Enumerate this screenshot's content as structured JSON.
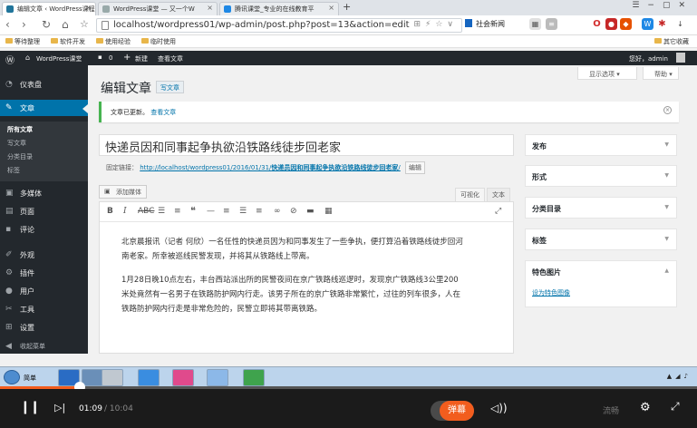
{
  "browser": {
    "tabs": [
      {
        "title": "编辑文章 ‹ WordPress课程"
      },
      {
        "title": "WordPress课堂 — 又一个W"
      },
      {
        "title": "腾讯课堂_专业的在线教育平"
      }
    ],
    "url": "localhost/wordpress01/wp-admin/post.php?post=13&action=edit",
    "social_news": "社会新闻",
    "bookmarks": [
      "等待整理",
      "软件开发",
      "使用经验",
      "临时使用"
    ],
    "other_bookmarks": "其它收藏"
  },
  "admin_bar": {
    "site_name": "WordPress课堂",
    "comments": "0",
    "new": "新建",
    "view_post": "查看文章",
    "greeting": "您好，admin"
  },
  "sidebar": {
    "items": [
      {
        "label": "仪表盘",
        "icon": "dashboard-icon"
      },
      {
        "label": "文章",
        "icon": "pin-icon"
      },
      {
        "label": "多媒体",
        "icon": "media-icon"
      },
      {
        "label": "页面",
        "icon": "page-icon"
      },
      {
        "label": "评论",
        "icon": "comment-icon"
      },
      {
        "label": "外观",
        "icon": "brush-icon"
      },
      {
        "label": "插件",
        "icon": "plugin-icon"
      },
      {
        "label": "用户",
        "icon": "user-icon"
      },
      {
        "label": "工具",
        "icon": "wrench-icon"
      },
      {
        "label": "设置",
        "icon": "settings-icon"
      },
      {
        "label": "收起菜单",
        "icon": "collapse-icon"
      }
    ],
    "submenu": [
      "所有文章",
      "写文章",
      "分类目录",
      "标签"
    ]
  },
  "header": {
    "screen_options": "显示选项 ▾",
    "help": "帮助 ▾",
    "title": "编辑文章",
    "add_new": "写文章"
  },
  "notice": {
    "text": "文章已更新。",
    "link": "查看文章"
  },
  "post": {
    "title": "快递员因和同事起争执欲沿铁路线徒步回老家",
    "permalink_label": "固定链接：",
    "permalink_base": "http://localhost/wordpress01/2016/01/31/",
    "permalink_slug": "快递员因和同事起争执欲沿铁路线徒步回老家",
    "permalink_end": "/",
    "edit_button": "编辑",
    "add_media": "添加媒体",
    "tab_visual": "可视化",
    "tab_text": "文本",
    "paragraphs": [
      "北京晨报讯（记者 何欣）一名任性的快递员因为和同事发生了一些争执，便打算沿着铁路线徒步回河南老家。所幸被巡线民警发现，并将其从铁路线上带离。",
      "1月28日晚10点左右，丰台西站派出所的民警夜间在京广铁路线巡逻时，发现京广铁路线3公里200米处竟然有一名男子在铁路防护网内行走。该男子所在的京广铁路非常繁忙，过往的列车很多，人在铁路防护网内行走是非常危险的，民警立即将其带离铁路。"
    ]
  },
  "metaboxes": {
    "publish": "发布",
    "format": "形式",
    "categories": "分类目录",
    "tags": "标签",
    "featured_image": "特色图片",
    "set_featured": "设为特色图像"
  },
  "taskbar": {
    "start": "简单"
  },
  "player": {
    "current_time": "01:09",
    "total_time": "/ 10:04",
    "danmu": "弹幕",
    "quality": "流畅",
    "progress": 0.114,
    "accent": "#f25d1e"
  }
}
